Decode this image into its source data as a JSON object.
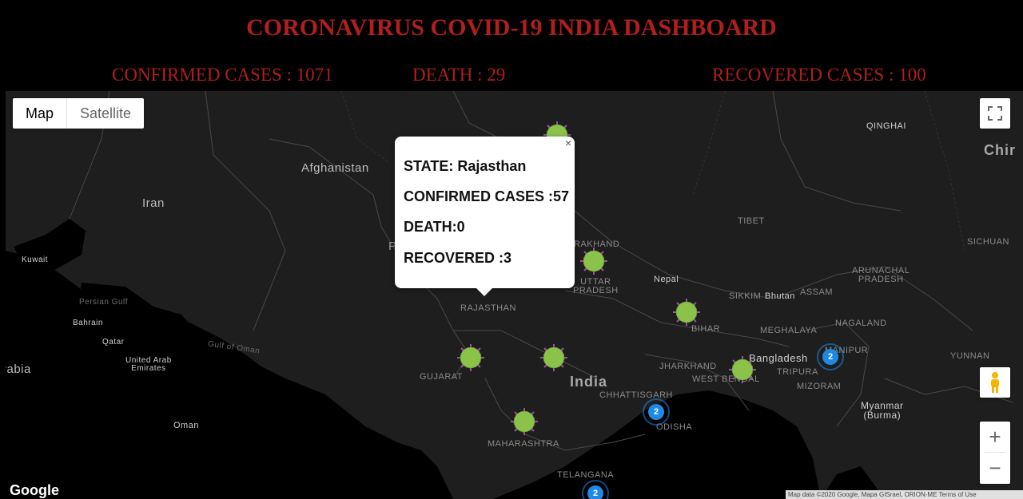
{
  "header": {
    "title": "CORONAVIRUS COVID-19 INDIA DASHBOARD",
    "confirmed": "CONFIRMED CASES : 1071",
    "death": "DEATH : 29",
    "recovered": "RECOVERED CASES : 100"
  },
  "map": {
    "type_map": "Map",
    "type_satellite": "Satellite",
    "zoom_in": "+",
    "zoom_out": "−",
    "google": "Google",
    "attribution": "Map data ©2020 Google, Mapa GISrael, ORION-ME  Terms of Use",
    "labels": {
      "qinghai": "QINGHAI",
      "china": "Chir",
      "afghanistan": "Afghanistan",
      "iran": "Iran",
      "tibet": "TIBET",
      "sichuan": "SICHUAN",
      "kuwait": "Kuwait",
      "uttarakhand": "RAKHAND",
      "arunachal": "ARUNACHAL\nPRADESH",
      "p": "P",
      "nepal": "Nepal",
      "uttar_pradesh": "UTTAR\nPRADESH",
      "persian_gulf": "Persian Gulf",
      "sikkim": "SIKKIM",
      "bhutan": "Bhutan",
      "assam": "ASSAM",
      "rajasthan": "RAJASTHAN",
      "bahrain": "Bahrain",
      "bihar": "BIHAR",
      "meghalaya": "MEGHALAYA",
      "nagaland": "NAGALAND",
      "qatar": "Qatar",
      "gulf_of_oman": "Gulf of Oman",
      "manipur": "MANIPUR",
      "uae": "United Arab\nEmirates",
      "bangladesh": "Bangladesh",
      "yunnan": "YUNNAN",
      "arabia": "rabia",
      "jharkhand": "JHARKHAND",
      "tripura": "TRIPURA",
      "gujarat": "GUJARAT",
      "india": "India",
      "west_bengal": "WEST BENGAL",
      "chhattisgarh": "CHHATTISGARH",
      "mizoram": "MIZORAM",
      "myanmar": "Myanmar\n(Burma)",
      "oman": "Oman",
      "odisha": "ODISHA",
      "maharashtra": "MAHARASHTRA",
      "telangana": "TELANGANA"
    },
    "clusters": [
      "2",
      "2",
      "2"
    ]
  },
  "popup": {
    "state": "STATE: Rajasthan",
    "confirmed": "CONFIRMED CASES :57",
    "death": "DEATH:0",
    "recovered": "RECOVERED :3",
    "close": "×"
  },
  "colors": {
    "accent": "#b01e1e",
    "virus": "#8bc34a",
    "cluster": "#1e88e5"
  }
}
